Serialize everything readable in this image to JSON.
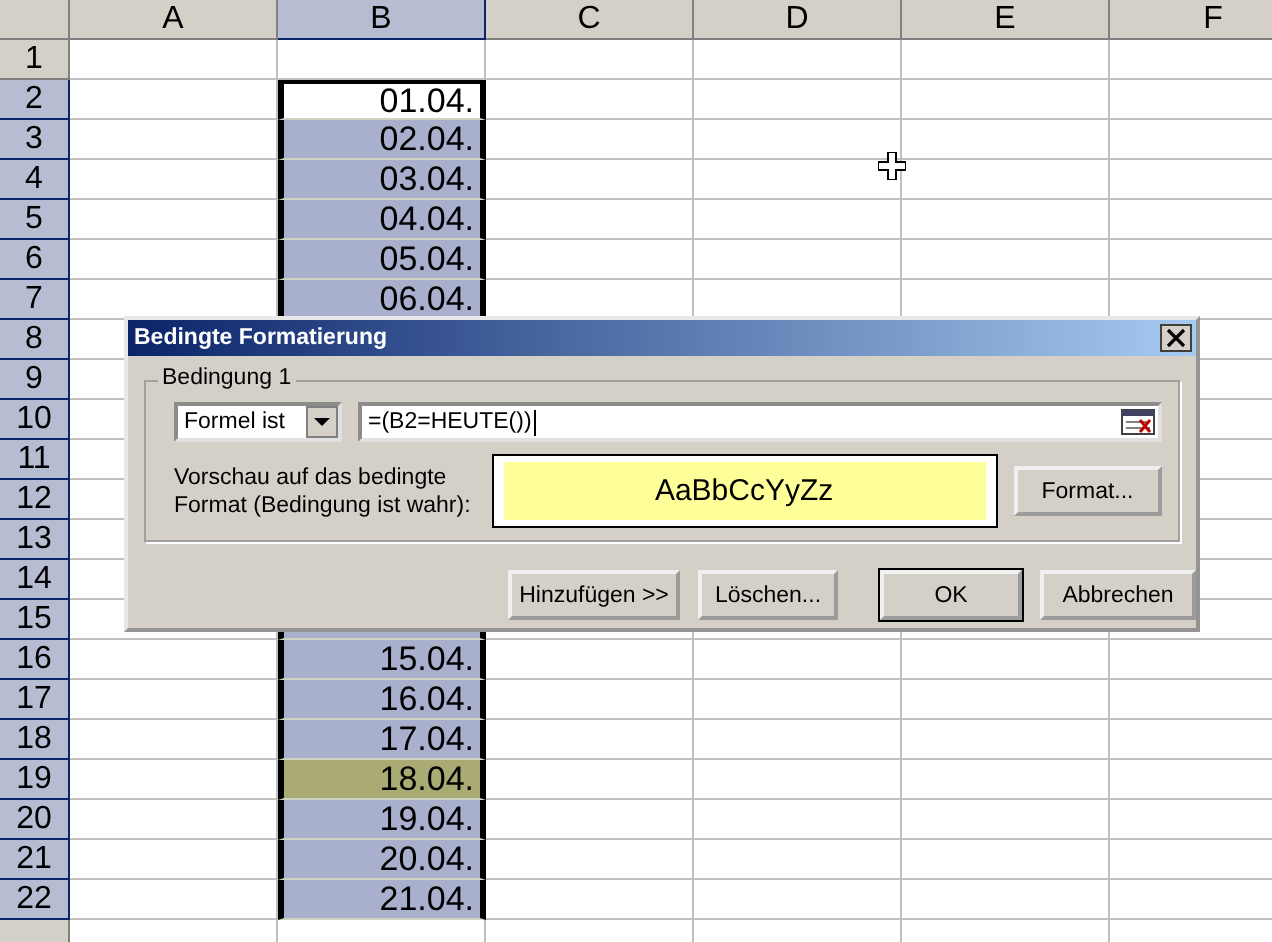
{
  "columns": [
    {
      "label": "A",
      "selected": false
    },
    {
      "label": "B",
      "selected": true
    },
    {
      "label": "C",
      "selected": false
    },
    {
      "label": "D",
      "selected": false
    },
    {
      "label": "E",
      "selected": false
    },
    {
      "label": "F",
      "selected": false
    }
  ],
  "rows": [
    {
      "label": "1",
      "selected": false,
      "active": false,
      "highlighted": false
    },
    {
      "label": "2",
      "selected": true,
      "value": "01.04.",
      "active": true,
      "highlighted": false
    },
    {
      "label": "3",
      "selected": true,
      "value": "02.04.",
      "active": false,
      "highlighted": false
    },
    {
      "label": "4",
      "selected": true,
      "value": "03.04.",
      "active": false,
      "highlighted": false
    },
    {
      "label": "5",
      "selected": true,
      "value": "04.04.",
      "active": false,
      "highlighted": false
    },
    {
      "label": "6",
      "selected": true,
      "value": "05.04.",
      "active": false,
      "highlighted": false
    },
    {
      "label": "7",
      "selected": true,
      "value": "06.04.",
      "active": false,
      "highlighted": false
    },
    {
      "label": "8",
      "selected": true,
      "active": false,
      "highlighted": false
    },
    {
      "label": "9",
      "selected": true,
      "active": false,
      "highlighted": false
    },
    {
      "label": "10",
      "selected": true,
      "active": false,
      "highlighted": false
    },
    {
      "label": "11",
      "selected": true,
      "active": false,
      "highlighted": false
    },
    {
      "label": "12",
      "selected": true,
      "active": false,
      "highlighted": false
    },
    {
      "label": "13",
      "selected": true,
      "active": false,
      "highlighted": false
    },
    {
      "label": "14",
      "selected": true,
      "active": false,
      "highlighted": false
    },
    {
      "label": "15",
      "selected": true,
      "active": false,
      "highlighted": false
    },
    {
      "label": "16",
      "selected": true,
      "value": "15.04.",
      "active": false,
      "highlighted": false
    },
    {
      "label": "17",
      "selected": true,
      "value": "16.04.",
      "active": false,
      "highlighted": false
    },
    {
      "label": "18",
      "selected": true,
      "value": "17.04.",
      "active": false,
      "highlighted": false
    },
    {
      "label": "19",
      "selected": true,
      "value": "18.04.",
      "active": false,
      "highlighted": true
    },
    {
      "label": "20",
      "selected": true,
      "value": "19.04.",
      "active": false,
      "highlighted": false
    },
    {
      "label": "21",
      "selected": true,
      "value": "20.04.",
      "active": false,
      "highlighted": false
    },
    {
      "label": "22",
      "selected": true,
      "value": "21.04.",
      "active": false,
      "highlighted": false
    }
  ],
  "dialog": {
    "title": "Bedingte Formatierung",
    "group_label": "Bedingung 1",
    "condition_type": "Formel ist",
    "formula": "=(B2=HEUTE())",
    "preview_label": "Vorschau auf das bedingte Format (Bedingung ist wahr):",
    "preview_sample": "AaBbCcYyZz",
    "format_button": "Format...",
    "buttons": [
      {
        "label": "Hinzufügen >>",
        "default": false
      },
      {
        "label": "Löschen...",
        "default": false
      },
      {
        "label": "OK",
        "default": true
      },
      {
        "label": "Abbrechen",
        "default": false
      }
    ]
  }
}
